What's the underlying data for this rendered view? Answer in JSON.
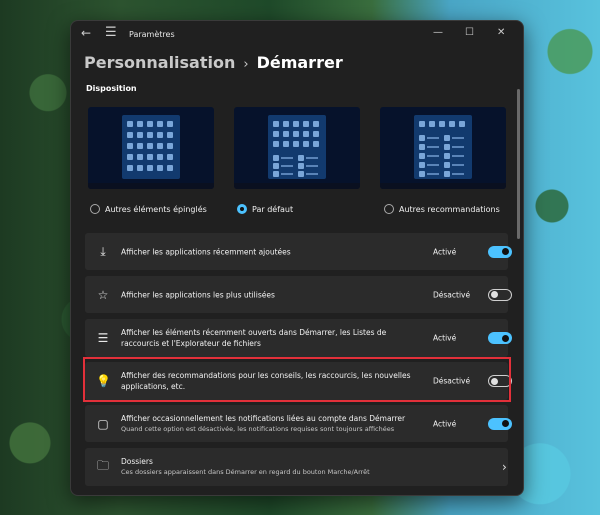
{
  "window": {
    "title": "Paramètres",
    "back_glyph": "←",
    "menu_glyph": "☰",
    "min_glyph": "—",
    "max_glyph": "☐",
    "close_glyph": "✕"
  },
  "breadcrumb": {
    "parent": "Personnalisation",
    "separator": "›",
    "current": "Démarrer"
  },
  "disposition": {
    "label": "Disposition",
    "options": [
      {
        "label": "Autres éléments épinglés",
        "selected": false
      },
      {
        "label": "Par défaut",
        "selected": true
      },
      {
        "label": "Autres recommandations",
        "selected": false
      }
    ]
  },
  "settings": [
    {
      "icon": "download-icon",
      "glyph": "⤓",
      "label": "Afficher les applications récemment ajoutées",
      "sub": "",
      "state": "Activé",
      "on": true
    },
    {
      "icon": "star-icon",
      "glyph": "☆",
      "label": "Afficher les applications les plus utilisées",
      "sub": "",
      "state": "Désactivé",
      "on": false
    },
    {
      "icon": "list-icon",
      "glyph": "☰",
      "label": "Afficher les éléments récemment ouverts dans Démarrer, les Listes de raccourcis et l'Explorateur de fichiers",
      "sub": "",
      "state": "Activé",
      "on": true
    },
    {
      "icon": "lightbulb-icon",
      "glyph": "💡",
      "label": "Afficher des recommandations pour les conseils, les raccourcis, les nouvelles applications, etc.",
      "sub": "",
      "state": "Désactivé",
      "on": false
    },
    {
      "icon": "notification-icon",
      "glyph": "▢",
      "label": "Afficher occasionnellement les notifications liées au compte dans Démarrer",
      "sub": "Quand cette option est désactivée, les notifications requises sont toujours affichées",
      "state": "Activé",
      "on": true
    }
  ],
  "folders": {
    "glyph": "🗀",
    "label": "Dossiers",
    "sub": "Ces dossiers apparaissent dans Démarrer en regard du bouton Marche/Arrêt",
    "chevron": "›"
  },
  "colors": {
    "accent": "#4cc2ff",
    "window_bg": "#202020",
    "row_bg": "#2b2b2b",
    "highlight": "#e2303a"
  }
}
